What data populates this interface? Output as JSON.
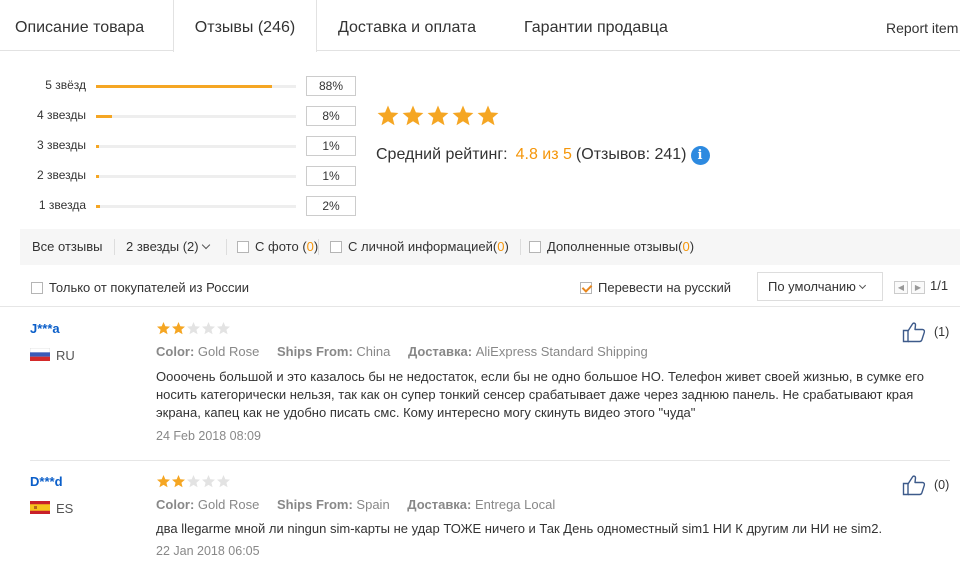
{
  "tabs": [
    {
      "label": "Описание товара"
    },
    {
      "label": "Отзывы (246)"
    },
    {
      "label": "Доставка и оплата"
    },
    {
      "label": "Гарантии продавца"
    }
  ],
  "report_link": "Report item",
  "histogram": [
    {
      "label": "5 звёзд",
      "percent_text": "88%",
      "fill": 0.88
    },
    {
      "label": "4 звезды",
      "percent_text": "8%",
      "fill": 0.08
    },
    {
      "label": "3 звезды",
      "percent_text": "1%",
      "fill": 0.01
    },
    {
      "label": "2 звезды",
      "percent_text": "1%",
      "fill": 0.01
    },
    {
      "label": "1 звезда",
      "percent_text": "2%",
      "fill": 0.02
    }
  ],
  "summary": {
    "stars": 5,
    "avg_label": "Средний рейтинг:",
    "avg_value": "4.8 из 5",
    "count_text": "(Отзывов: 241)",
    "info_glyph": "i"
  },
  "filters": {
    "all": "Все отзывы",
    "star_filter": "2 звезды (2)",
    "with_photo": {
      "label": "С фото",
      "open": "(",
      "count": "0",
      "close": ")"
    },
    "with_info": {
      "label": "С личной информацией",
      "open": "(",
      "count": "0",
      "close": ")"
    },
    "with_additional": {
      "label": "Дополненные отзывы",
      "open": "(",
      "count": "0",
      "close": ")"
    }
  },
  "options": {
    "russia_only": "Только от покупателей из России",
    "translate": "Перевести на русский",
    "translate_checked": true,
    "sort_value": "По умолчанию",
    "pager_prev": "◀",
    "pager_next": "▶",
    "page": "1/1"
  },
  "reviews": [
    {
      "user": "J***a",
      "country": "RU",
      "rating": 2,
      "color_label": "Color:",
      "color_value": "Gold Rose",
      "ships_label": "Ships From:",
      "ships_value": "China",
      "delivery_label": "Доставка:",
      "delivery_value": "AliExpress Standard Shipping",
      "text": "Оооочень большой и это казалось бы не недостаток, если бы не одно большое НО. Телефон живет своей жизнью, в сумке его носить категорически нельзя, так как он супер тонкий сенсер срабатывает даже через заднюю панель. Не срабатывают края экрана, капец как не удобно писать смс. Кому интересно могу скинуть видео этого \"чуда\"",
      "date": "24 Feb 2018 08:09",
      "likes": "(1)"
    },
    {
      "user": "D***d",
      "country": "ES",
      "rating": 2,
      "color_label": "Color:",
      "color_value": "Gold Rose",
      "ships_label": "Ships From:",
      "ships_value": "Spain",
      "delivery_label": "Доставка:",
      "delivery_value": "Entrega Local",
      "text": "два llegarme мной ли ningun sim-карты не удар ТОЖЕ ничего и Так День одноместный sim1 НИ К другим ли НИ не sim2.",
      "date": "22 Jan 2018 06:05",
      "likes": "(0)"
    }
  ],
  "colors": {
    "accent": "#f5960a",
    "star_gold": "#f5a623",
    "star_empty": "#e3e3e3",
    "link_blue": "#0a5ec9",
    "info_blue": "#2d8ae0"
  }
}
